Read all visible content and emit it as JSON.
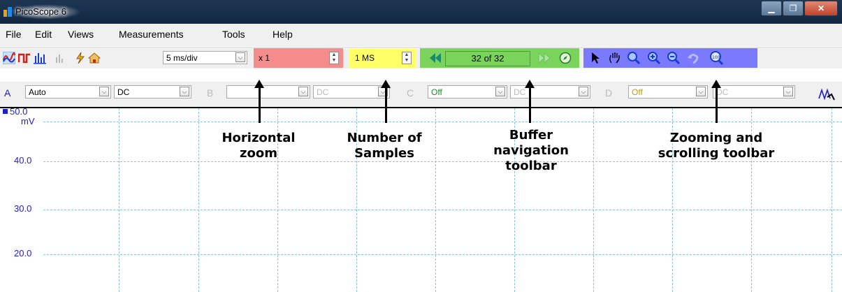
{
  "window": {
    "title": "PicoScope 6"
  },
  "menu": [
    "File",
    "Edit",
    "Views",
    "Measurements",
    "Tools",
    "Help"
  ],
  "toolbar": {
    "timebase": "5 ms/div",
    "zoom": "x 1",
    "samples": "1 MS",
    "buffer": "32 of 32"
  },
  "channels": [
    {
      "letter": "A",
      "range": "Auto",
      "coupling": "DC"
    },
    {
      "letter": "B",
      "range": "",
      "coupling": "DC"
    },
    {
      "letter": "C",
      "range": "Off",
      "coupling": "DC"
    },
    {
      "letter": "D",
      "range": "Off",
      "coupling": "DC"
    }
  ],
  "graph": {
    "y_labels": [
      "50.0",
      "mV",
      "40.0",
      "30.0",
      "20.0"
    ]
  },
  "annotations": [
    "Horizontal\nzoom",
    "Number of\nSamples",
    "Buffer\nnavigation\ntoolbar",
    "Zooming and\nscrolling toolbar"
  ],
  "colors": {
    "zoom_zone": "#f48c8c",
    "samples_zone": "#ffff66",
    "buffer_zone": "#7ad35a",
    "zoom_tools_zone": "#7a7aff",
    "grid": "#8fc6d6",
    "axis_text": "#1d1dcc"
  }
}
